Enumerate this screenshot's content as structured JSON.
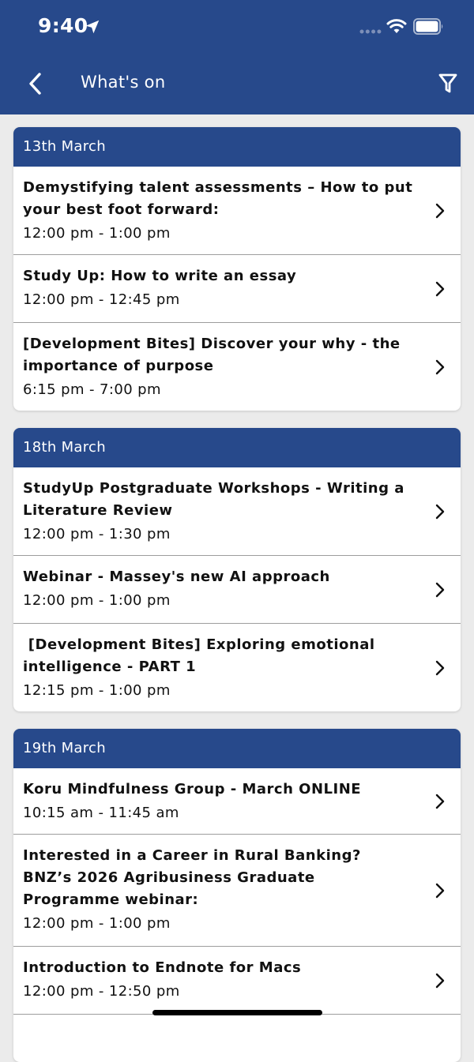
{
  "status_bar": {
    "time": "9:40"
  },
  "nav": {
    "title": "What's on"
  },
  "sections": [
    {
      "date": "13th March",
      "events": [
        {
          "title": "Demystifying talent assessments – How to put your best foot forward:",
          "time": "12:00 pm - 1:00 pm"
        },
        {
          "title": "Study Up: How to write an essay",
          "time": "12:00 pm - 12:45 pm"
        },
        {
          "title": "[Development Bites] Discover your why - the importance of purpose",
          "time": "6:15 pm - 7:00 pm"
        }
      ]
    },
    {
      "date": "18th March",
      "events": [
        {
          "title": "StudyUp  Postgraduate Workshops - Writing a Literature Review",
          "time": "12:00 pm - 1:30 pm"
        },
        {
          "title": "Webinar - Massey's new AI approach",
          "time": "12:00 pm - 1:00 pm"
        },
        {
          "title": " [Development Bites] Exploring emotional intelligence - PART 1",
          "time": "12:15 pm - 1:00 pm"
        }
      ]
    },
    {
      "date": "19th March",
      "events": [
        {
          "title": "Koru Mindfulness Group - March ONLINE",
          "time": "10:15 am - 11:45 am"
        },
        {
          "title": "Interested in a Career in Rural Banking? BNZ’s 2026 Agribusiness Graduate Programme webinar:",
          "time": "12:00 pm - 1:00 pm"
        },
        {
          "title": "Introduction to Endnote for Macs",
          "time": "12:00 pm - 12:50 pm"
        }
      ]
    }
  ],
  "colors": {
    "header": "#27498b",
    "background": "#ebebeb"
  },
  "icons": {
    "back": "chevron-left-icon",
    "filter": "filter-funnel-icon",
    "row": "chevron-right-icon"
  }
}
